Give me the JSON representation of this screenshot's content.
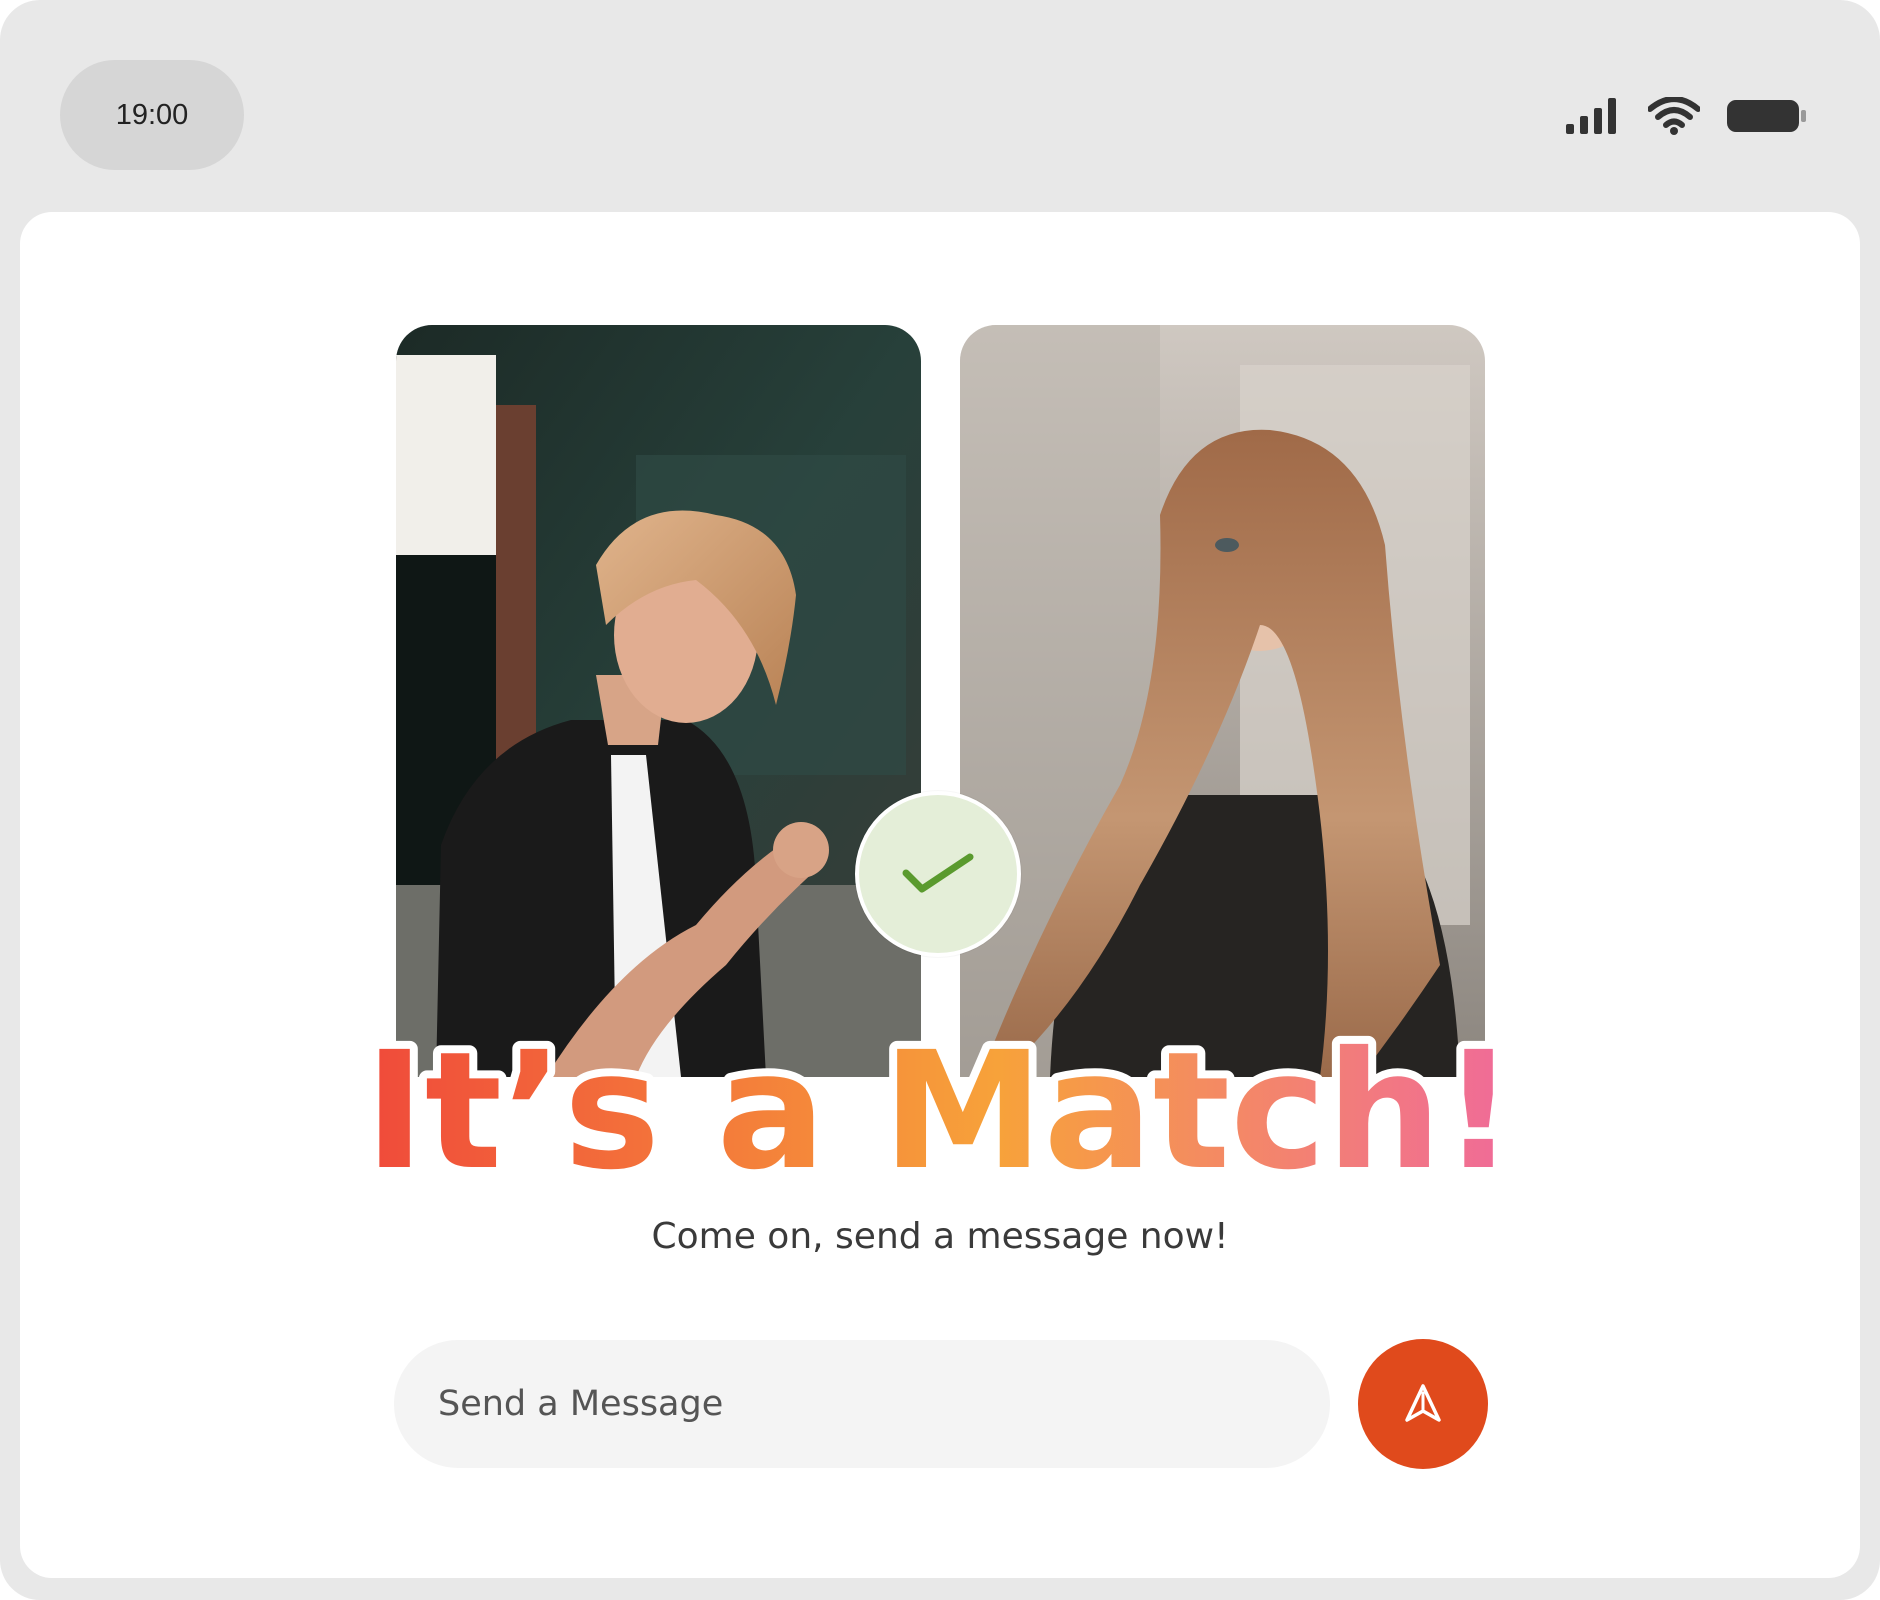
{
  "status_bar": {
    "time": "19:00",
    "icons": [
      "signal-icon",
      "wifi-icon",
      "battery-icon"
    ]
  },
  "match": {
    "title": "It’s a Match!",
    "subtitle": "Come on, send a message now!",
    "badge_icon": "checkmark-icon",
    "photos": [
      "man-profile-photo",
      "woman-profile-photo"
    ]
  },
  "composer": {
    "placeholder": "Send a Message",
    "send_icon": "send-arrow-icon"
  },
  "colors": {
    "send_button": "#e04a1c",
    "badge_bg": "#e4eed8",
    "badge_check": "#5a9a2e",
    "title_gradient": [
      "#f04a3a",
      "#f7a23a",
      "#f06a9a"
    ]
  }
}
